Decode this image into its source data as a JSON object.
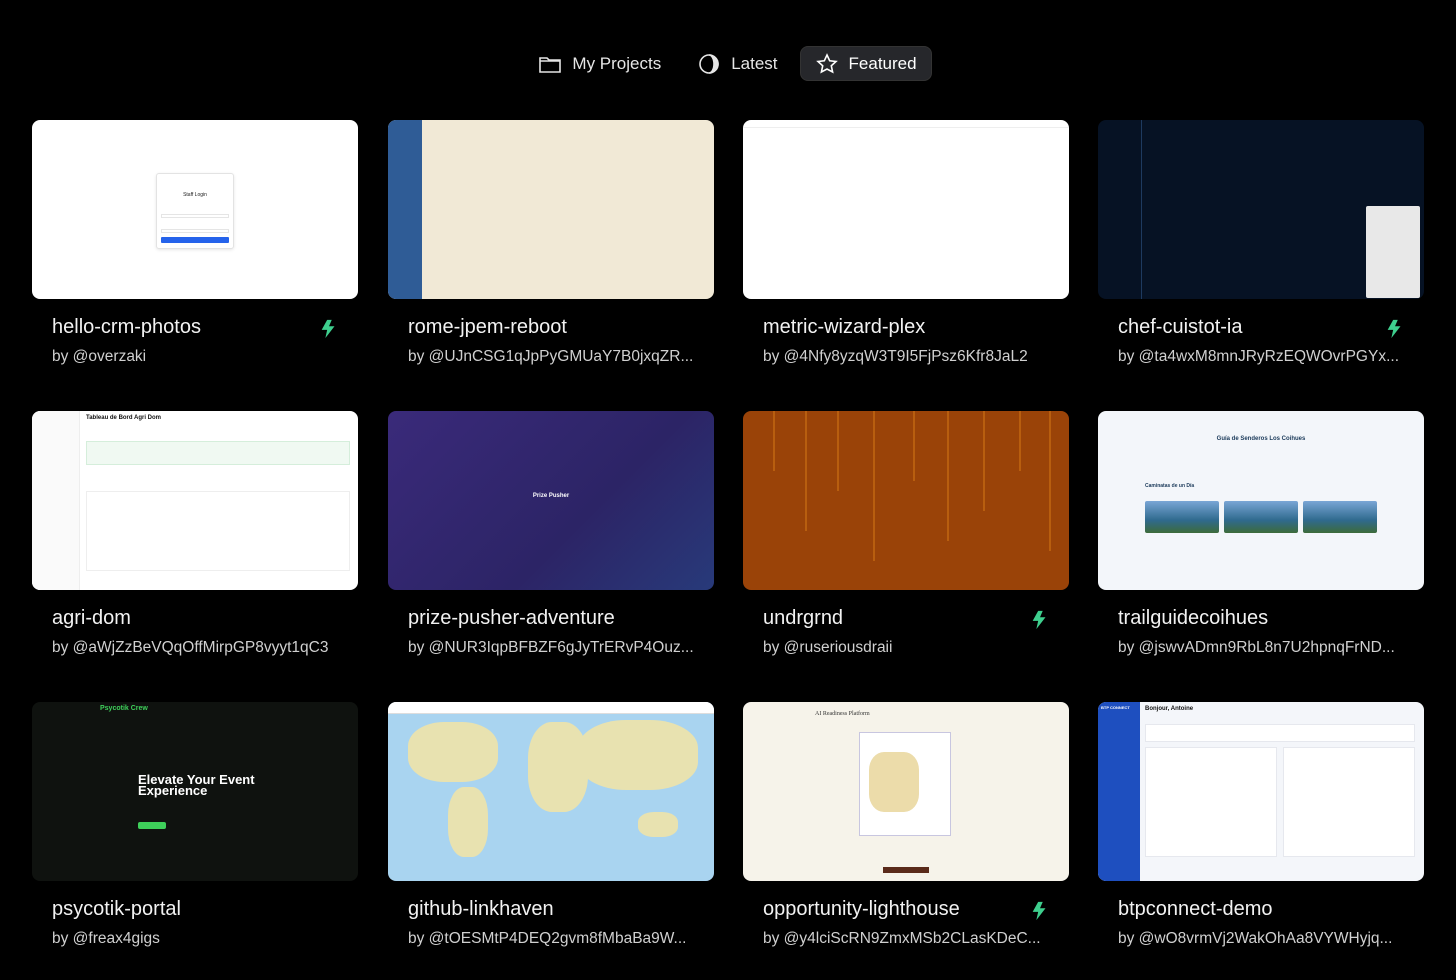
{
  "tabs": [
    {
      "label": "My Projects",
      "icon": "folder-icon",
      "active": false
    },
    {
      "label": "Latest",
      "icon": "half-circle-icon",
      "active": false
    },
    {
      "label": "Featured",
      "icon": "star-icon",
      "active": true
    }
  ],
  "accent_color": "#3ecf8e",
  "projects": [
    {
      "title": "hello-crm-photos",
      "author": "by @overzaki",
      "featured": true
    },
    {
      "title": "rome-jpem-reboot",
      "author": "by @UJnCSG1qJpPyGMUaY7B0jxqZR...",
      "featured": false
    },
    {
      "title": "metric-wizard-plex",
      "author": "by @4Nfy8yzqW3T9I5FjPsz6Kfr8JaL2",
      "featured": false
    },
    {
      "title": "chef-cuistot-ia",
      "author": "by @ta4wxM8mnJRyRzEQWOvrPGYx...",
      "featured": true
    },
    {
      "title": "agri-dom",
      "author": "by @aWjZzBeVQqOffMirpGP8vyyt1qC3",
      "featured": false
    },
    {
      "title": "prize-pusher-adventure",
      "author": "by @NUR3IqpBFBZF6gJyTrERvP4Ouz...",
      "featured": false
    },
    {
      "title": "undrgrnd",
      "author": "by @ruseriousdraii",
      "featured": true
    },
    {
      "title": "trailguidecoihues",
      "author": "by @jswvADmn9RbL8n7U2hpnqFrND...",
      "featured": false
    },
    {
      "title": "psycotik-portal",
      "author": "by @freax4gigs",
      "featured": false
    },
    {
      "title": "github-linkhaven",
      "author": "by @tOESMtP4DEQ2gvm8fMbaBa9W...",
      "featured": false
    },
    {
      "title": "opportunity-lighthouse",
      "author": "by @y4lciScRN9ZmxMSb2CLasKDeC...",
      "featured": true
    },
    {
      "title": "btpconnect-demo",
      "author": "by @wO8vrmVj2WakOhAa8VYWHyjq...",
      "featured": false
    }
  ],
  "thumb_text": {
    "staff_login": "Staff Login",
    "tableau": "Tableau de Bord Agri Dom",
    "prize_pusher": "Prize Pusher",
    "guia": "Guía de Senderos Los Coihues",
    "caminatas": "Caminatas de un Día",
    "psy_brand": "Psycotik Crew",
    "psy_hero": "Elevate Your Event Experience",
    "ai_title": "AI Readiness Platform",
    "btp_greeting": "Bonjour, Antoine",
    "btp_brand": "BTP CONNECT"
  }
}
